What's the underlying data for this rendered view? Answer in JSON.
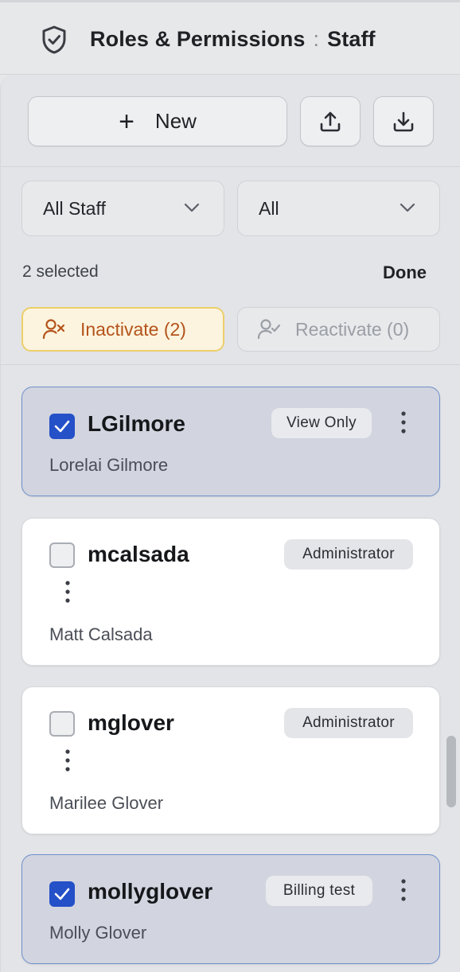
{
  "header": {
    "icon": "shield-check-icon",
    "title": "Roles & Permissions",
    "separator": ":",
    "section": "Staff"
  },
  "toolbar": {
    "new_label": "New",
    "new_icon": "plus-icon",
    "upload_icon": "upload-icon",
    "download_icon": "download-icon"
  },
  "filters": {
    "staff_filter": "All Staff",
    "status_filter": "All"
  },
  "selection": {
    "count_label": "2 selected",
    "done_label": "Done",
    "inactivate_label": "Inactivate (2)",
    "reactivate_label": "Reactivate (0)"
  },
  "staff": [
    {
      "username": "LGilmore",
      "full_name": "Lorelai Gilmore",
      "role": "View Only",
      "checked": true
    },
    {
      "username": "mcalsada",
      "full_name": "Matt Calsada",
      "role": "Administrator",
      "checked": false
    },
    {
      "username": "mglover",
      "full_name": "Marilee Glover",
      "role": "Administrator",
      "checked": false
    },
    {
      "username": "mollyglover",
      "full_name": "Molly Glover",
      "role": "Billing test",
      "checked": true
    }
  ],
  "colors": {
    "accent_blue": "#2450c8",
    "inactivate_text": "#b4531b",
    "inactivate_border": "#ecce6b",
    "selected_card_bg": "#d2d5df"
  }
}
